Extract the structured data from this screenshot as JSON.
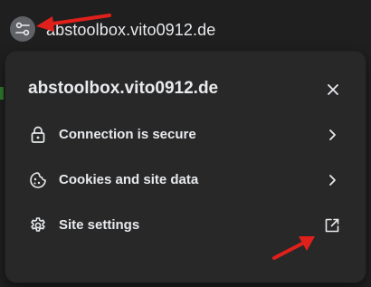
{
  "omnibox": {
    "url": "abstoolbox.vito0912.de",
    "site_info_icon": "tune-icon"
  },
  "popup": {
    "title": "abstoolbox.vito0912.de",
    "close_icon": "close-icon",
    "rows": [
      {
        "label": "Connection is secure",
        "icon": "lock-icon",
        "trailing": "chevron-right-icon"
      },
      {
        "label": "Cookies and site data",
        "icon": "cookie-icon",
        "trailing": "chevron-right-icon"
      },
      {
        "label": "Site settings",
        "icon": "gear-icon",
        "trailing": "open-in-new-icon"
      }
    ]
  },
  "annotations": {
    "arrow_color": "#e0201b"
  },
  "colors": {
    "background": "#1f1f1f",
    "popup": "#282828",
    "text": "#e8eaed",
    "site_info_button": "#5f6368"
  }
}
